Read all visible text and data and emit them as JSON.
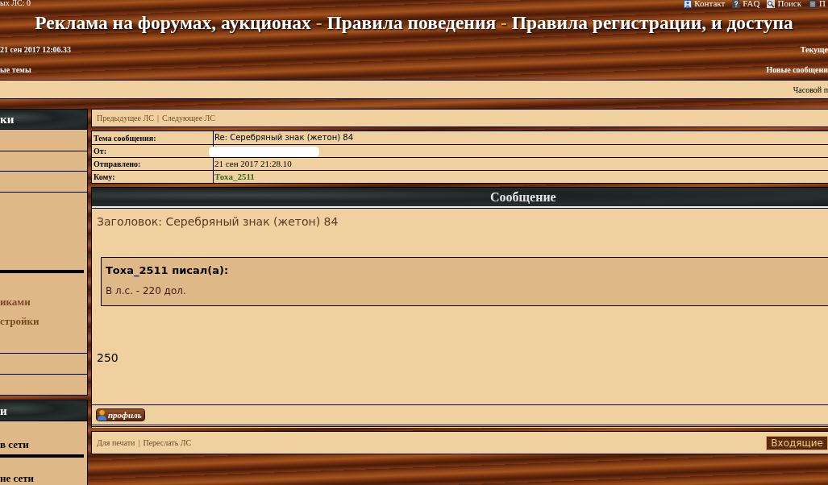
{
  "top_bar": {
    "left_text": "ых ЛС: 0",
    "links": [
      {
        "label": "Контакт"
      },
      {
        "label": "FAQ"
      },
      {
        "label": "Поиск"
      },
      {
        "label": "П"
      }
    ]
  },
  "title": [
    {
      "kind": "text",
      "text": "Реклама на форумах, аукционах"
    },
    {
      "kind": "separator",
      "text": "-"
    },
    {
      "kind": "text",
      "text": "Правила поведения"
    },
    {
      "kind": "separator",
      "text": "-"
    },
    {
      "kind": "text",
      "text": "Правила регистрации, и доступа"
    }
  ],
  "info_rows": [
    {
      "left": "21 сен 2017 12:06.33",
      "right": "Текуще"
    },
    {
      "left": "ые темы",
      "right": "Новые сообщени"
    }
  ],
  "timezone_bar": {
    "text": "Часовой п"
  },
  "sidebar": {
    "sections": [
      {
        "title": "ки",
        "items": [
          {
            "kind": "link",
            "label": "иками"
          },
          {
            "kind": "link",
            "label": "стройки"
          }
        ]
      },
      {
        "title": "и",
        "items": [
          {
            "kind": "label",
            "label": "в сети"
          },
          {
            "kind": "label",
            "label": "не сети"
          }
        ]
      }
    ]
  },
  "message_nav": {
    "links": [
      "Предыдущее ЛС",
      "Следующее ЛС"
    ],
    "separator": "|"
  },
  "message_fields": [
    {
      "kind": "subject",
      "label": "Тема сообщения:",
      "value": "Re: Серебряный знак (жетон) 84"
    },
    {
      "kind": "redacted",
      "label": "От:"
    },
    {
      "kind": "date",
      "label": "Отправлено:",
      "value": "21 сен 2017 21:28.10"
    },
    {
      "kind": "user",
      "label": "Кому:",
      "value": "Тоха_2511"
    }
  ],
  "message": {
    "header": "Сообщение",
    "subject": "Заголовок: Серебряный знак (жетон) 84",
    "quote": {
      "author": "Тоха_2511 писал(а):",
      "text": "В л.с. - 220 дол."
    },
    "body": "250",
    "profile_button": "профиль"
  },
  "footer": {
    "links": [
      "Для печати",
      "Переслать ЛС"
    ],
    "separator": "|",
    "inbox_button": "Входящие"
  }
}
